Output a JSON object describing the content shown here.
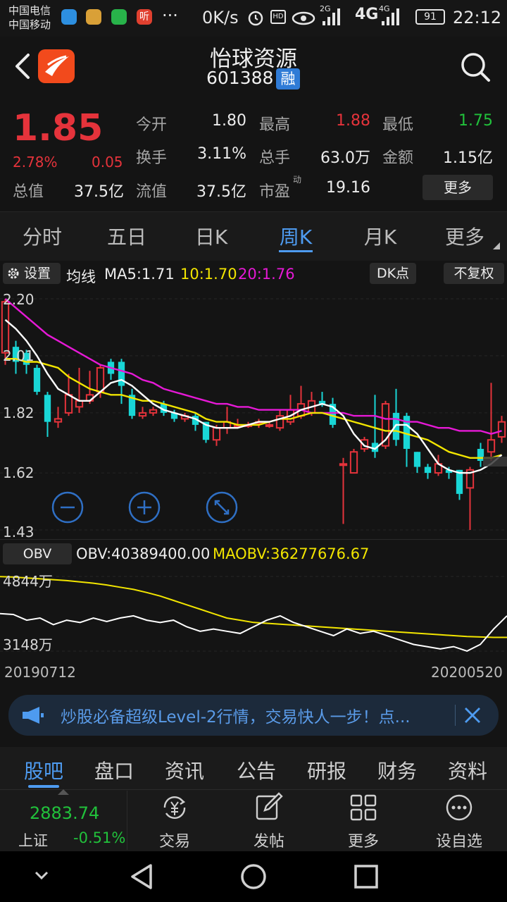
{
  "status_bar": {
    "carrier_1": "中国电信",
    "carrier_2": "中国移动",
    "app_icon_4": "听",
    "more": "···",
    "speed": "0K/s",
    "hd": "HD",
    "net_2g": "2G",
    "net_4g_big": "4G",
    "net_4g_small": "4G",
    "battery": "91",
    "time": "22:12"
  },
  "header": {
    "name": "怡球资源",
    "code": "601388",
    "badge": "融"
  },
  "quote": {
    "price": "1.85",
    "change_pct": "2.78%",
    "change": "0.05",
    "total_value_label": "总值",
    "total_value": "37.5亿",
    "rows": [
      {
        "label": "今开",
        "value": "1.80",
        "color": "white"
      },
      {
        "label": "最高",
        "value": "1.88",
        "color": "red"
      },
      {
        "label": "最低",
        "value": "1.75",
        "color": "green"
      },
      {
        "label": "换手",
        "value": "3.11%",
        "color": "white"
      },
      {
        "label": "总手",
        "value": "63.0万",
        "color": "white"
      },
      {
        "label": "金额",
        "value": "1.15亿",
        "color": "white"
      },
      {
        "label": "流值",
        "value": "37.5亿",
        "color": "white"
      },
      {
        "label": "市盈",
        "value": "19.16",
        "color": "white"
      }
    ],
    "pe_superscript": "动",
    "more_button": "更多"
  },
  "period_tabs": [
    "分时",
    "五日",
    "日K",
    "周K",
    "月K",
    "更多"
  ],
  "active_period": 3,
  "ma_legend": {
    "settings": "设置",
    "ma_label": "均线",
    "ma5": "MA5:1.71",
    "ma10": "10:1.70",
    "ma20": "20:1.76",
    "dk_button": "DK点",
    "restore_button": "不复权"
  },
  "chart_data": [
    {
      "type": "candlestick",
      "title": "周K",
      "y_ticks": [
        "2.20",
        "2.01",
        "1.82",
        "1.62",
        "1.43"
      ],
      "ylim": [
        1.43,
        2.2
      ],
      "candles": [
        {
          "o": 2.02,
          "c": 2.19,
          "h": 2.2,
          "l": 1.98
        },
        {
          "o": 2.04,
          "c": 1.99,
          "h": 2.06,
          "l": 1.95
        },
        {
          "o": 2.02,
          "c": 1.98,
          "h": 2.03,
          "l": 1.95
        },
        {
          "o": 1.97,
          "c": 1.89,
          "h": 1.98,
          "l": 1.88
        },
        {
          "o": 1.88,
          "c": 1.79,
          "h": 1.89,
          "l": 1.74
        },
        {
          "o": 1.79,
          "c": 1.8,
          "h": 1.84,
          "l": 1.77
        },
        {
          "o": 1.82,
          "c": 1.88,
          "h": 1.95,
          "l": 1.81
        },
        {
          "o": 1.84,
          "c": 1.86,
          "h": 1.97,
          "l": 1.82
        },
        {
          "o": 1.86,
          "c": 1.88,
          "h": 1.96,
          "l": 1.85
        },
        {
          "o": 1.89,
          "c": 1.97,
          "h": 1.98,
          "l": 1.87
        },
        {
          "o": 1.99,
          "c": 1.95,
          "h": 2.0,
          "l": 1.93
        },
        {
          "o": 1.99,
          "c": 1.91,
          "h": 2.0,
          "l": 1.85
        },
        {
          "o": 1.88,
          "c": 1.81,
          "h": 1.9,
          "l": 1.8
        },
        {
          "o": 1.81,
          "c": 1.82,
          "h": 1.84,
          "l": 1.8
        },
        {
          "o": 1.82,
          "c": 1.83,
          "h": 1.84,
          "l": 1.81
        },
        {
          "o": 1.85,
          "c": 1.82,
          "h": 1.86,
          "l": 1.81
        },
        {
          "o": 1.82,
          "c": 1.8,
          "h": 1.83,
          "l": 1.79
        },
        {
          "o": 1.8,
          "c": 1.81,
          "h": 1.82,
          "l": 1.79
        },
        {
          "o": 1.81,
          "c": 1.78,
          "h": 1.82,
          "l": 1.76
        },
        {
          "o": 1.79,
          "c": 1.73,
          "h": 1.79,
          "l": 1.72
        },
        {
          "o": 1.73,
          "c": 1.77,
          "h": 1.78,
          "l": 1.71
        },
        {
          "o": 1.77,
          "c": 1.79,
          "h": 1.84,
          "l": 1.75
        },
        {
          "o": 1.78,
          "c": 1.78,
          "h": 1.8,
          "l": 1.77
        },
        {
          "o": 1.78,
          "c": 1.78,
          "h": 1.79,
          "l": 1.77
        },
        {
          "o": 1.79,
          "c": 1.79,
          "h": 1.8,
          "l": 1.77
        },
        {
          "o": 1.78,
          "c": 1.78,
          "h": 1.79,
          "l": 1.77
        },
        {
          "o": 1.77,
          "c": 1.81,
          "h": 1.83,
          "l": 1.76
        },
        {
          "o": 1.79,
          "c": 1.83,
          "h": 1.88,
          "l": 1.78
        },
        {
          "o": 1.81,
          "c": 1.85,
          "h": 1.91,
          "l": 1.8
        },
        {
          "o": 1.82,
          "c": 1.86,
          "h": 1.89,
          "l": 1.81
        },
        {
          "o": 1.86,
          "c": 1.85,
          "h": 1.89,
          "l": 1.84
        },
        {
          "o": 1.85,
          "c": 1.78,
          "h": 1.87,
          "l": 1.77
        },
        {
          "o": 1.65,
          "c": 1.65,
          "h": 1.67,
          "l": 1.45
        },
        {
          "o": 1.62,
          "c": 1.69,
          "h": 1.7,
          "l": 1.62
        },
        {
          "o": 1.7,
          "c": 1.73,
          "h": 1.74,
          "l": 1.69
        },
        {
          "o": 1.72,
          "c": 1.69,
          "h": 1.88,
          "l": 1.67
        },
        {
          "o": 1.71,
          "c": 1.85,
          "h": 1.86,
          "l": 1.7
        },
        {
          "o": 1.82,
          "c": 1.73,
          "h": 1.9,
          "l": 1.71
        },
        {
          "o": 1.81,
          "c": 1.7,
          "h": 1.82,
          "l": 1.64
        },
        {
          "o": 1.69,
          "c": 1.64,
          "h": 1.69,
          "l": 1.62
        },
        {
          "o": 1.64,
          "c": 1.62,
          "h": 1.65,
          "l": 1.6
        },
        {
          "o": 1.62,
          "c": 1.65,
          "h": 1.68,
          "l": 1.61
        },
        {
          "o": 1.63,
          "c": 1.62,
          "h": 1.64,
          "l": 1.6
        },
        {
          "o": 1.63,
          "c": 1.55,
          "h": 1.63,
          "l": 1.53
        },
        {
          "o": 1.57,
          "c": 1.63,
          "h": 1.64,
          "l": 1.43
        },
        {
          "o": 1.7,
          "c": 1.66,
          "h": 1.72,
          "l": 1.64
        },
        {
          "o": 1.69,
          "c": 1.73,
          "h": 1.92,
          "l": 1.66
        },
        {
          "o": 1.74,
          "c": 1.79,
          "h": 1.81,
          "l": 1.72
        }
      ],
      "ma5": [
        2.13,
        2.1,
        2.06,
        2.01,
        1.95,
        1.9,
        1.88,
        1.86,
        1.86,
        1.89,
        1.92,
        1.93,
        1.91,
        1.88,
        1.85,
        1.83,
        1.82,
        1.81,
        1.8,
        1.78,
        1.77,
        1.77,
        1.77,
        1.78,
        1.79,
        1.79,
        1.8,
        1.81,
        1.83,
        1.84,
        1.85,
        1.84,
        1.81,
        1.75,
        1.71,
        1.7,
        1.73,
        1.78,
        1.78,
        1.75,
        1.7,
        1.65,
        1.63,
        1.62,
        1.62,
        1.63,
        1.65,
        1.68
      ],
      "ma10": [
        2.0,
        2.0,
        1.99,
        1.99,
        1.98,
        1.97,
        1.94,
        1.92,
        1.9,
        1.89,
        1.88,
        1.88,
        1.87,
        1.86,
        1.86,
        1.85,
        1.84,
        1.83,
        1.82,
        1.8,
        1.79,
        1.79,
        1.78,
        1.78,
        1.78,
        1.79,
        1.8,
        1.8,
        1.81,
        1.82,
        1.82,
        1.81,
        1.8,
        1.79,
        1.78,
        1.77,
        1.76,
        1.76,
        1.75,
        1.74,
        1.73,
        1.71,
        1.69,
        1.68,
        1.67,
        1.67,
        1.67,
        1.68
      ],
      "ma20": [
        2.2,
        2.17,
        2.14,
        2.11,
        2.08,
        2.06,
        2.04,
        2.02,
        2.0,
        1.98,
        1.97,
        1.96,
        1.95,
        1.93,
        1.92,
        1.9,
        1.89,
        1.88,
        1.87,
        1.86,
        1.85,
        1.85,
        1.84,
        1.84,
        1.83,
        1.83,
        1.83,
        1.83,
        1.83,
        1.82,
        1.82,
        1.82,
        1.82,
        1.81,
        1.81,
        1.81,
        1.8,
        1.8,
        1.79,
        1.79,
        1.78,
        1.77,
        1.77,
        1.76,
        1.76,
        1.76,
        1.75,
        1.76
      ]
    },
    {
      "type": "line",
      "title": "OBV",
      "y_ticks": [
        "4844万",
        "3148万"
      ],
      "ylim": [
        3148,
        4844
      ],
      "series": [
        {
          "name": "OBV",
          "values": [
            4000,
            3980,
            3850,
            3900,
            3750,
            3850,
            3800,
            3900,
            3820,
            3900,
            3950,
            3850,
            3800,
            3850,
            3700,
            3600,
            3650,
            3600,
            3550,
            3700,
            3850,
            3950,
            3800,
            3700,
            3600,
            3500,
            3650,
            3550,
            3600,
            3500,
            3400,
            3300,
            3250,
            3200,
            3250,
            3150,
            3300,
            3650,
            3950
          ]
        },
        {
          "name": "MAOBV",
          "values": [
            4840,
            4830,
            4810,
            4790,
            4770,
            4750,
            4720,
            4690,
            4650,
            4600,
            4550,
            4480,
            4400,
            4300,
            4200,
            4100,
            4000,
            3900,
            3850,
            3800,
            3780,
            3760,
            3740,
            3720,
            3700,
            3680,
            3660,
            3640,
            3620,
            3600,
            3580,
            3560,
            3540,
            3520,
            3500,
            3480,
            3470,
            3460,
            3460
          ]
        }
      ],
      "start_date": "20190712",
      "end_date": "20200520"
    }
  ],
  "obv_legend": {
    "button": "OBV",
    "obv": "OBV:40389400.00",
    "maobv": "MAOBV:36277676.67"
  },
  "banner": {
    "text": "炒股必备超级Level-2行情，交易快人一步！点..."
  },
  "sub_tabs": [
    "股吧",
    "盘口",
    "资讯",
    "公告",
    "研报",
    "财务",
    "资料"
  ],
  "active_sub_tab": 0,
  "toolbar": {
    "index_value": "2883.74",
    "index_name": "上证",
    "index_change": "-0.51%",
    "items": [
      {
        "label": "交易",
        "icon": "yuan-cycle-icon"
      },
      {
        "label": "发帖",
        "icon": "edit-icon"
      },
      {
        "label": "更多",
        "icon": "grid-icon"
      },
      {
        "label": "设自选",
        "icon": "more-dots-icon"
      }
    ]
  },
  "colors": {
    "up": "#e5333b",
    "down": "#19d6d6",
    "ma5": "#ffffff",
    "ma10": "#f2e500",
    "ma20": "#e619d6",
    "accent": "#4e9bf0"
  }
}
